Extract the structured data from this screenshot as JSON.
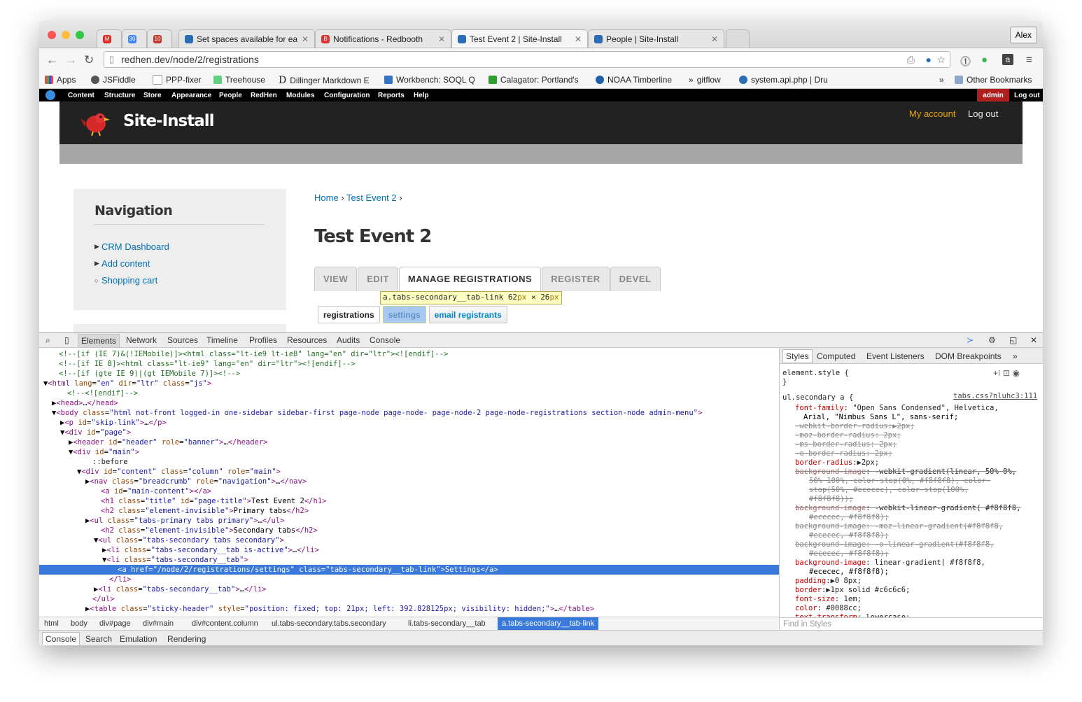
{
  "tabs": [
    {
      "label": "",
      "color": "#d93025",
      "icon": "M"
    },
    {
      "label": "",
      "color": "#4285f4",
      "icon": "30"
    },
    {
      "label": "",
      "color": "#c0392b",
      "icon": "10"
    },
    {
      "label": "Set spaces available for ea",
      "color": "#2a6db5",
      "icon": "drupal-icon"
    },
    {
      "label": "Notifications - Redbooth",
      "color": "#d33",
      "icon": "B"
    },
    {
      "label": "Test Event 2 | Site-Install",
      "color": "#2a6db5",
      "icon": "drupal-icon"
    },
    {
      "label": "People | Site-Install",
      "color": "#2a6db5",
      "icon": "drupal-icon"
    }
  ],
  "profile": "Alex",
  "url": "redhen.dev/node/2/registrations",
  "bookmarks": [
    "Apps",
    "JSFiddle",
    "PPP-fixer",
    "Treehouse",
    "Dillinger Markdown E",
    "Workbench: SOQL Q",
    "Calagator: Portland's",
    "NOAA Timberline",
    "gitflow",
    "system.api.php | Dru",
    "Other Bookmarks"
  ],
  "admin_menu": [
    "Content",
    "Structure",
    "Store",
    "Appearance",
    "People",
    "RedHen",
    "Modules",
    "Configuration",
    "Reports",
    "Help"
  ],
  "admin_user": "admin",
  "admin_logout": "Log out",
  "site": {
    "name": "Site-Install",
    "my_account": "My account",
    "log_out": "Log out"
  },
  "sidebar": {
    "title": "Navigation",
    "links": [
      "CRM Dashboard",
      "Add content",
      "Shopping cart"
    ]
  },
  "breadcrumb": {
    "home": "Home",
    "sep": "›",
    "event": "Test Event 2"
  },
  "page_title": "Test Event 2",
  "primary_tabs": [
    "VIEW",
    "EDIT",
    "MANAGE REGISTRATIONS",
    "REGISTER",
    "DEVEL"
  ],
  "tooltip": {
    "selector": "a.tabs-secondary__tab-link",
    "w": "62",
    "h": "26",
    "unit": "px",
    "times": "×"
  },
  "secondary_tabs": [
    "registrations",
    "settings",
    "email registrants"
  ],
  "devtools": {
    "tabs": [
      "Elements",
      "Network",
      "Sources",
      "Timeline",
      "Profiles",
      "Resources",
      "Audits",
      "Console"
    ],
    "dom_lines": [
      "<!--[if (IE 7)&(!IEMobile)]><html class=\"lt-ie9 lt-ie8\"  lang=\"en\" dir=\"ltr\"><![endif]-->",
      "<!--[if IE 8]><html class=\"lt-ie9\"  lang=\"en\" dir=\"ltr\"><![endif]-->",
      "<!--[if (gte IE 9)|(gt IEMobile 7)]><!-->",
      "▼<html lang=\"en\" dir=\"ltr\" class=\"js\">",
      "<!--<![endif]-->",
      "▶<head>…</head>",
      "▼<body class=\"html not-front logged-in one-sidebar sidebar-first page-node page-node- page-node-2 page-node-registrations section-node admin-menu\">",
      "▶<p id=\"skip-link\">…</p>",
      "▼<div id=\"page\">",
      "▶<header id=\"header\" role=\"banner\">…</header>",
      "▼<div id=\"main\">",
      "::before",
      "▼<div id=\"content\" class=\"column\" role=\"main\">",
      "▶<nav class=\"breadcrumb\" role=\"navigation\">…</nav>",
      "<a id=\"main-content\"></a>",
      "<h1 class=\"title\" id=\"page-title\">Test Event 2</h1>",
      "<h2 class=\"element-invisible\">Primary tabs</h2>",
      "▶<ul class=\"tabs-primary tabs primary\">…</ul>",
      "<h2 class=\"element-invisible\">Secondary tabs</h2>",
      "▼<ul class=\"tabs-secondary tabs secondary\">",
      "▶<li class=\"tabs-secondary__tab is-active\">…</li>",
      "▼<li class=\"tabs-secondary__tab\">",
      "<a href=\"/node/2/registrations/settings\" class=\"tabs-secondary__tab-link\">Settings</a>",
      "</li>",
      "▶<li class=\"tabs-secondary__tab\">…</li>",
      "</ul>",
      "▶<table class=\"sticky-header\" style=\"position: fixed; top: 21px; left: 392.828125px; visibility: hidden;\">…</table>"
    ],
    "breadcrumbs": [
      "html",
      "body",
      "div#page",
      "div#main",
      "div#content.column",
      "ul.tabs-secondary.tabs.secondary",
      "li.tabs-secondary__tab",
      "a.tabs-secondary__tab-link"
    ],
    "styles_tabs": [
      "Styles",
      "Computed",
      "Event Listeners",
      "DOM Breakpoints",
      "»"
    ],
    "style_lines": [
      "element.style {",
      "}",
      "ul.secondary a {",
      "font-family: \"Open Sans Condensed\", Helvetica,",
      "Arial, \"Nimbus Sans L\", sans-serif;",
      "-webkit-border-radius:▶2px;",
      "-moz-border-radius: 2px;",
      "-ms-border-radius: 2px;",
      "-o-border-radius: 2px;",
      "border-radius:▶2px;",
      "background-image: -webkit-gradient(linear, 50% 0%,",
      "50% 100%, color-stop(0%, #f8f8f8), color-",
      "stop(50%, #ececec), color-stop(100%,",
      "#f8f8f8));",
      "background-image: -webkit-linear-gradient( #f8f8f8,",
      "#ececec,  #f8f8f8);",
      "background-image: -moz-linear-gradient(#f8f8f8,",
      "#ececec, #f8f8f8);",
      "background-image: -o-linear-gradient(#f8f8f8,",
      "#ececec, #f8f8f8);",
      "background-image: linear-gradient( #f8f8f8,",
      "#ececec,  #f8f8f8);",
      "padding:▶0 8px;",
      "border:▶1px solid  #c6c6c6;",
      "font-size: 1em;",
      "color:  #0088cc;",
      "text-transform: lowercase;"
    ],
    "style_source": "tabs.css?nluhc3:111",
    "find_placeholder": "Find in Styles",
    "drawer_tabs": [
      "Console",
      "Search",
      "Emulation",
      "Rendering"
    ]
  }
}
